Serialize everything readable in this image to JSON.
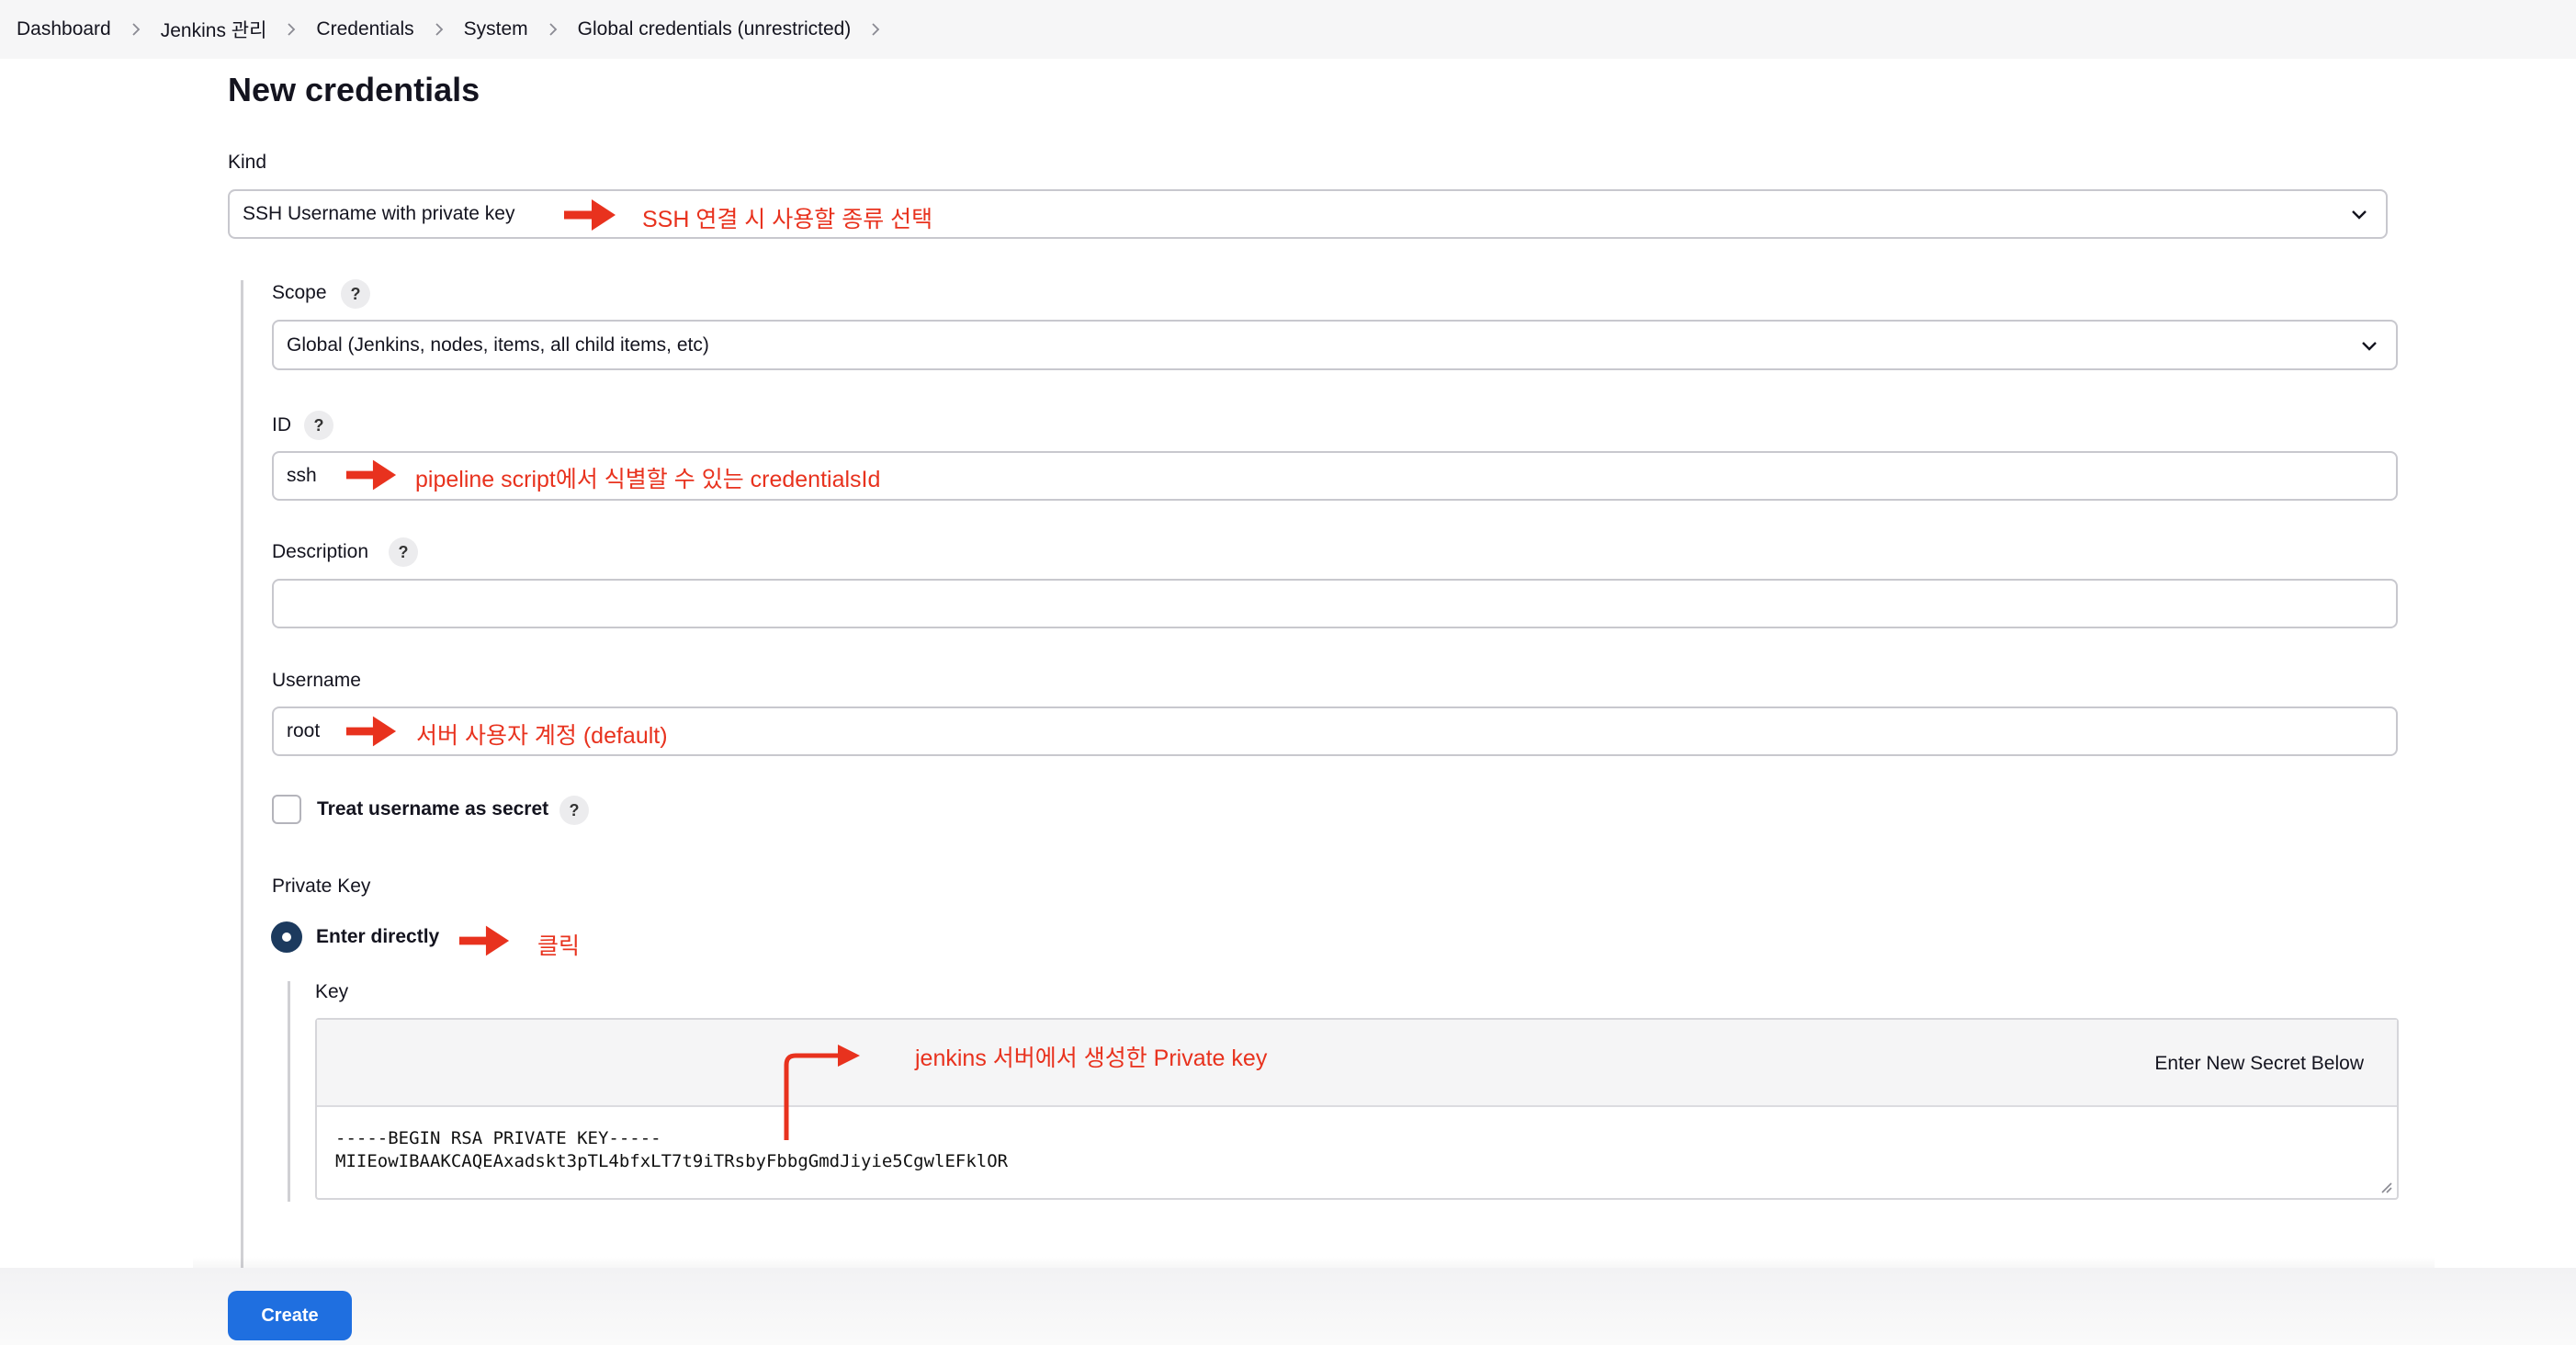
{
  "breadcrumb": {
    "items": [
      "Dashboard",
      "Jenkins 관리",
      "Credentials",
      "System",
      "Global credentials (unrestricted)"
    ]
  },
  "page": {
    "title": "New credentials"
  },
  "form": {
    "kind": {
      "label": "Kind",
      "value": "SSH Username with private key"
    },
    "scope": {
      "label": "Scope",
      "value": "Global (Jenkins, nodes, items, all child items, etc)"
    },
    "id": {
      "label": "ID",
      "value": "ssh"
    },
    "description": {
      "label": "Description",
      "value": ""
    },
    "username": {
      "label": "Username",
      "value": "root"
    },
    "treat_secret": {
      "label": "Treat username as secret",
      "checked": false
    },
    "private_key": {
      "label": "Private Key",
      "option_label": "Enter directly",
      "selected": true,
      "key_label": "Key",
      "secret_hint": "Enter New Secret Below",
      "value": "-----BEGIN RSA PRIVATE KEY-----\nMIIEowIBAAKCAQEAxadskt3pTL4bfxLT7t9iTRsbyFbbgGmdJiyie5CgwlEFklOR"
    },
    "help_symbol": "?"
  },
  "annotations": {
    "kind": "SSH 연결 시 사용할 종류 선택",
    "id": "pipeline script에서 식별할 수 있는 credentialsId",
    "username": "서버 사용자 계정 (default)",
    "enter_directly": "클릭",
    "key": "jenkins 서버에서 생성한 Private key",
    "color": "#e8321e"
  },
  "actions": {
    "create_label": "Create"
  },
  "colors": {
    "primary": "#1f6fe0",
    "radio": "#1c3a5e",
    "annotation": "#e8321e"
  }
}
